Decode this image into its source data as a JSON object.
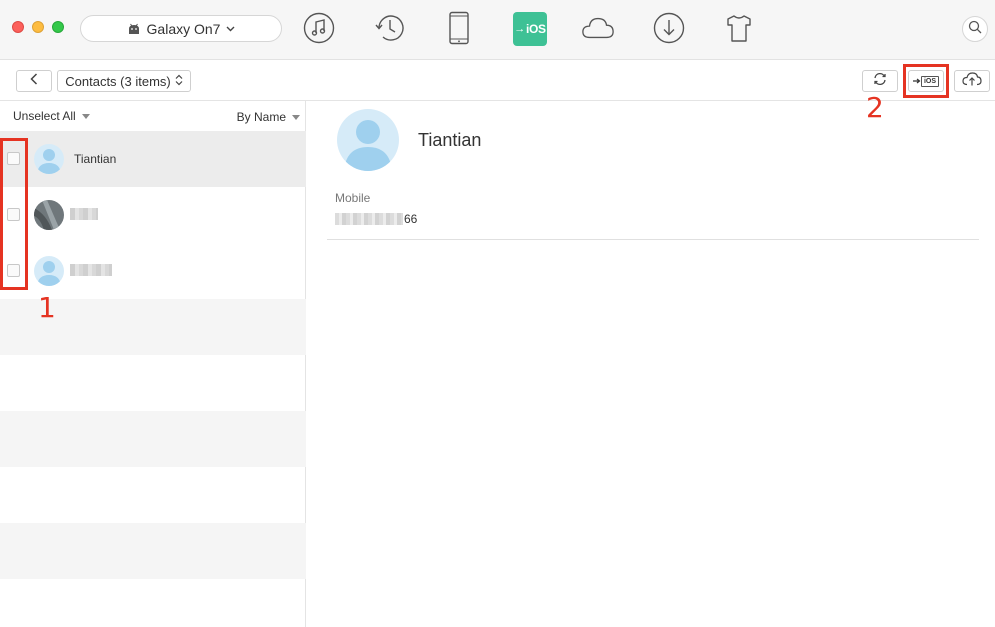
{
  "window": {
    "device_name": "Galaxy On7"
  },
  "nav_tabs": [
    {
      "name": "music-icon"
    },
    {
      "name": "history-icon"
    },
    {
      "name": "phone-icon"
    },
    {
      "name": "ios-transfer-icon",
      "label": "iOS",
      "active": true,
      "color": "#3ec195"
    },
    {
      "name": "cloud-icon"
    },
    {
      "name": "download-icon"
    },
    {
      "name": "tshirt-icon"
    }
  ],
  "toolbar": {
    "category_label": "Contacts (3 items)"
  },
  "list": {
    "unselect_all_label": "Unselect All",
    "sort_label": "By Name",
    "contacts": [
      {
        "name": "Tiantian",
        "selected": true
      },
      {
        "name": "",
        "selected": false
      },
      {
        "name": "",
        "selected": false
      }
    ]
  },
  "detail": {
    "name": "Tiantian",
    "field_label": "Mobile",
    "field_value_visible": "66"
  },
  "annotations": {
    "mark_1": "1",
    "mark_2": "2",
    "color": "#e53322"
  }
}
